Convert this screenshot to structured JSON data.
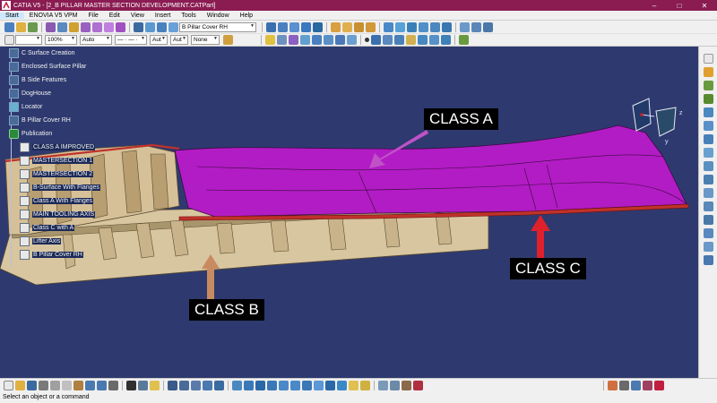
{
  "window": {
    "app_name": "CATIA V5",
    "document": "[2_B PILLAR MASTER SECTION DEVELOPMENT.CATPart]",
    "minimize": "–",
    "maximize": "□",
    "close": "✕"
  },
  "menu": {
    "items": [
      "Start",
      "ENOVIA V5 VPM",
      "File",
      "Edit",
      "View",
      "Insert",
      "Tools",
      "Window",
      "Help"
    ]
  },
  "toolbar": {
    "current_body": "B Pillar Cover RH",
    "line_color": "",
    "transparency": "100%",
    "line_thickness": "Auto",
    "line_type": "— · — ·",
    "point_type": "Aut",
    "layer_1": "Aut",
    "layer_2": "None"
  },
  "tree": {
    "nodes": [
      {
        "label": "C Surface Creation",
        "icon": "folder"
      },
      {
        "label": "Enclosed Surface Pillar",
        "icon": "folder"
      },
      {
        "label": "B Side Features",
        "icon": "folder"
      },
      {
        "label": "DogHouse",
        "icon": "folder"
      },
      {
        "label": "Locator",
        "icon": "folder"
      },
      {
        "label": "B Pillar Cover RH",
        "icon": "body"
      },
      {
        "label": "Publication",
        "icon": "publication"
      },
      {
        "label": "CLASS A IMPROVED",
        "icon": "pub-item"
      },
      {
        "label": "MASTERSECTION 1",
        "icon": "pub-item"
      },
      {
        "label": "MASTERSECTION 2",
        "icon": "pub-item"
      },
      {
        "label": "B-Surface With Flanges",
        "icon": "pub-item"
      },
      {
        "label": "Class A With Flanges",
        "icon": "pub-item"
      },
      {
        "label": "MAIN TOOLING AXIS",
        "icon": "pub-item"
      },
      {
        "label": "Class C with A",
        "icon": "pub-item"
      },
      {
        "label": "Lifter Axis",
        "icon": "pub-item"
      },
      {
        "label": "B Pillar Cover RH",
        "icon": "pub-item"
      }
    ]
  },
  "annotations": {
    "class_a": "CLASS A",
    "class_b": "CLASS B",
    "class_c": "CLASS C"
  },
  "compass": {
    "axis_x": "x",
    "axis_y": "y",
    "axis_z": "z"
  },
  "status": {
    "prompt": "Select an object or a command"
  },
  "colors": {
    "titlebar": "#8a1c52",
    "background": "#2e3a6f",
    "class_a_surface": "#b21cc4",
    "part_body": "#d8c6a0",
    "class_c_flange": "#c0322a",
    "arrow_a": "#c052c8",
    "arrow_b": "#c88a60",
    "arrow_c": "#e0202a"
  }
}
